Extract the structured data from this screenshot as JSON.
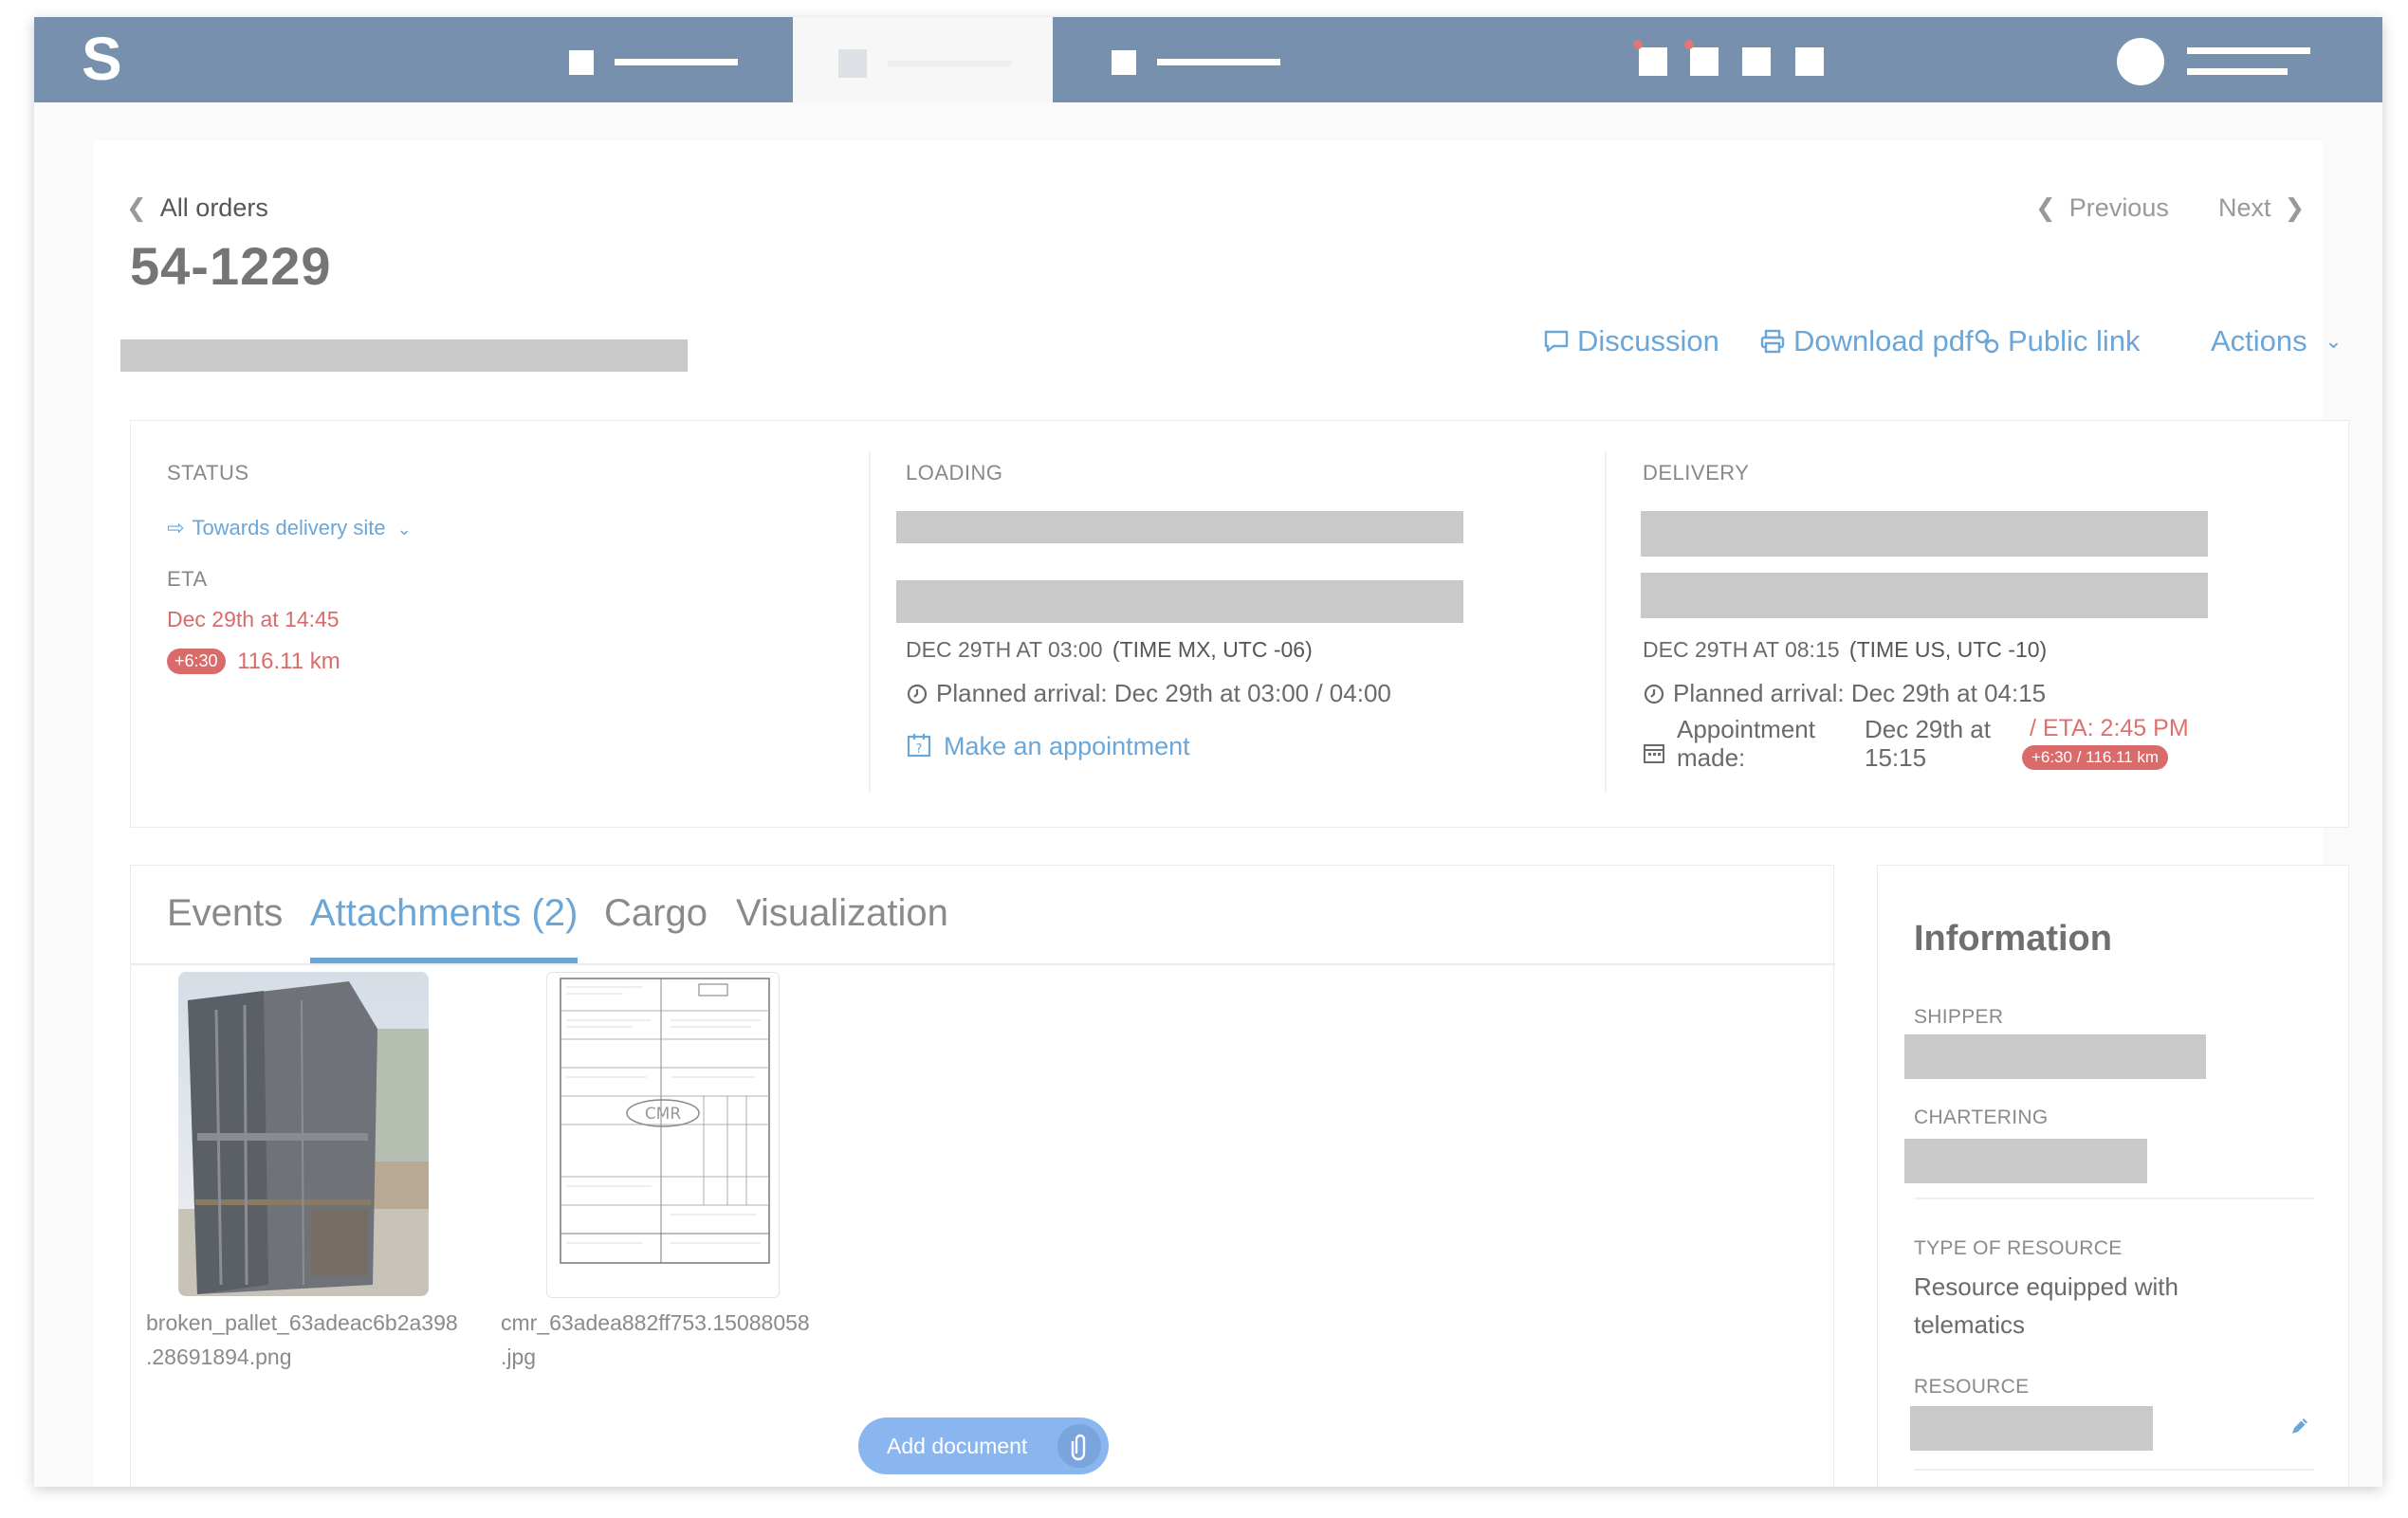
{
  "app": {
    "logo": "S"
  },
  "header": {
    "back_label": "All orders",
    "prev_label": "Previous",
    "next_label": "Next",
    "order_number": "54-1229"
  },
  "toolbar": {
    "discussion": "Discussion",
    "download": "Download pdf",
    "public_link": "Public link",
    "actions": "Actions"
  },
  "status": {
    "label": "STATUS",
    "value": "Towards delivery site",
    "eta_label": "ETA",
    "eta_value": "Dec 29th at 14:45",
    "delay_badge": "+6:30",
    "distance": "116.11 km"
  },
  "loading": {
    "label": "LOADING",
    "datetime": "DEC 29TH AT 03:00",
    "timezone": "(TIME MX, UTC -06)",
    "planned_arrival": "Planned arrival: Dec 29th at 03:00 / 04:00",
    "appointment_link": "Make an appointment"
  },
  "delivery": {
    "label": "DELIVERY",
    "datetime": "DEC 29TH AT 08:15",
    "timezone": "(TIME US, UTC -10)",
    "planned_arrival": "Planned arrival: Dec 29th at 04:15",
    "appointment_label_1": "Appointment",
    "appointment_label_2": "made:",
    "appointment_date_1": "Dec 29th at",
    "appointment_date_2": "15:15",
    "eta": "/ ETA: 2:45 PM",
    "eta_badge": "+6:30 / 116.11 km"
  },
  "tabs": [
    {
      "label": "Events"
    },
    {
      "label": "Attachments (2)"
    },
    {
      "label": "Cargo"
    },
    {
      "label": "Visualization"
    }
  ],
  "attachments": [
    {
      "name_line1": "broken_pallet_63adeac6b2a398",
      "name_line2": ".28691894.png"
    },
    {
      "name_line1": "cmr_63adea882ff753.15088058",
      "name_line2": ".jpg"
    }
  ],
  "cmr_stamp": "CMR",
  "add_document": "Add document",
  "information": {
    "title": "Information",
    "shipper_label": "SHIPPER",
    "chartering_label": "CHARTERING",
    "resource_type_label": "TYPE OF RESOURCE",
    "resource_type_line1": "Resource equipped with",
    "resource_type_line2": "telematics",
    "resource_label": "RESOURCE"
  },
  "colors": {
    "topbar": "#7690ad",
    "accent": "#6aa6d8",
    "alert": "#d96b6b",
    "button": "#8ab6ef"
  }
}
